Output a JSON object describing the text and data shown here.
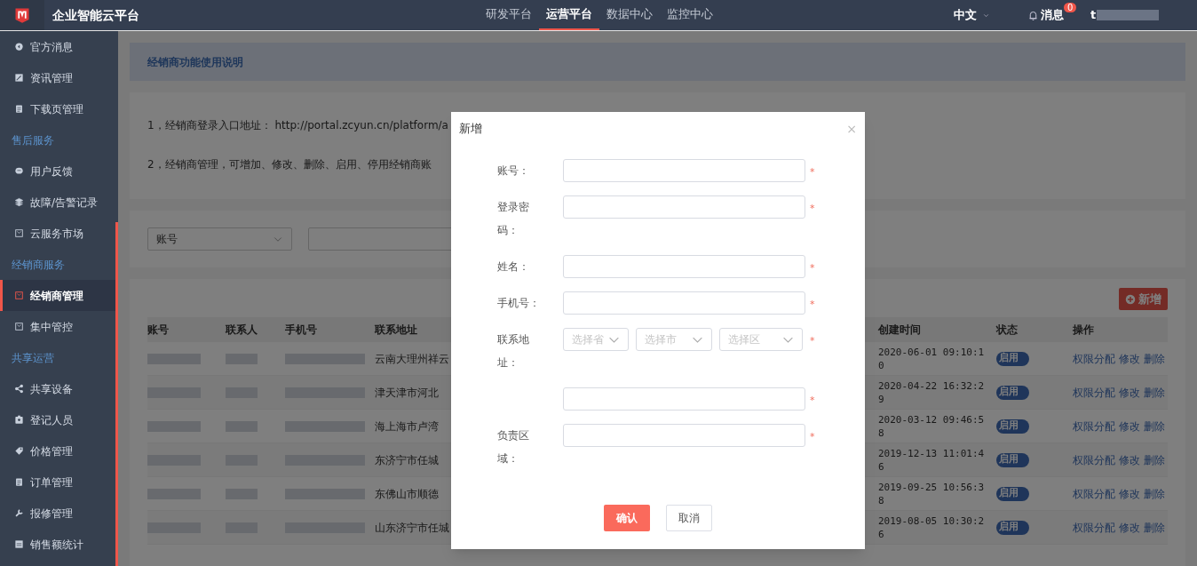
{
  "header": {
    "title": "企业智能云平台",
    "nav": [
      {
        "label": "研发平台",
        "selected": false
      },
      {
        "label": "运营平台",
        "selected": true
      },
      {
        "label": "数据中心",
        "selected": false
      },
      {
        "label": "监控中心",
        "selected": false
      }
    ],
    "language": "中文",
    "messages": {
      "label": "消息",
      "count": "0"
    },
    "user": "t"
  },
  "sidebar": [
    {
      "kind": "item",
      "label": "官方消息",
      "selected": false
    },
    {
      "kind": "item",
      "label": "资讯管理",
      "selected": false
    },
    {
      "kind": "item",
      "label": "下载页管理",
      "selected": false
    },
    {
      "kind": "section",
      "label": "售后服务"
    },
    {
      "kind": "item",
      "label": "用户反馈",
      "selected": false
    },
    {
      "kind": "item",
      "label": "故障/告警记录",
      "selected": false
    },
    {
      "kind": "item",
      "label": "云服务市场",
      "selected": false
    },
    {
      "kind": "section",
      "label": "经销商服务"
    },
    {
      "kind": "item",
      "label": "经销商管理",
      "selected": true
    },
    {
      "kind": "item",
      "label": "集中管控",
      "selected": false
    },
    {
      "kind": "section",
      "label": "共享运营"
    },
    {
      "kind": "item",
      "label": "共享设备",
      "selected": false
    },
    {
      "kind": "item",
      "label": "登记人员",
      "selected": false
    },
    {
      "kind": "item",
      "label": "价格管理",
      "selected": false
    },
    {
      "kind": "item",
      "label": "订单管理",
      "selected": false
    },
    {
      "kind": "item",
      "label": "报修管理",
      "selected": false
    },
    {
      "kind": "item",
      "label": "销售额统计",
      "selected": false
    }
  ],
  "info": {
    "title": "经销商功能使用说明",
    "lines": [
      "1，经销商登录入口地址： http://portal.zcyun.cn/platform/a",
      "2，经销商管理，可增加、修改、删除、启用、停用经销商账"
    ]
  },
  "filter": {
    "select": "账号"
  },
  "add_button": "新增",
  "table": {
    "columns_left": [
      "账号",
      "联系人",
      "手机号",
      "联系地址"
    ],
    "columns_right": [
      "创建时间",
      "状态",
      "操作"
    ],
    "rows": [
      {
        "address": "云南大理州祥云",
        "created": "2020-06-01 09:10:10",
        "status": {
          "label": "启用",
          "on": true
        },
        "actions": [
          "权限分配",
          "修改",
          "删除"
        ]
      },
      {
        "address": "津天津市河北",
        "created": "2020-04-22 16:32:29",
        "status": {
          "label": "启用",
          "on": true
        },
        "actions": [
          "权限分配",
          "修改",
          "删除"
        ]
      },
      {
        "address": "海上海市卢湾",
        "created": "2020-03-12 09:46:58",
        "status": {
          "label": "启用",
          "on": true
        },
        "actions": [
          "权限分配",
          "修改",
          "删除"
        ]
      },
      {
        "address": "东济宁市任城",
        "created": "2019-12-13 11:01:46",
        "status": {
          "label": "启用",
          "on": true
        },
        "actions": [
          "权限分配",
          "修改",
          "删除"
        ]
      },
      {
        "address": "东佛山市顺德",
        "created": "2019-09-25 10:56:38",
        "status": {
          "label": "启用",
          "on": true
        },
        "actions": [
          "权限分配",
          "修改",
          "删除"
        ]
      },
      {
        "address": "山东济宁市任城",
        "created": "2019-08-05 10:30:26",
        "status": {
          "label": "启用",
          "on": true
        },
        "actions": [
          "权限分配",
          "修改",
          "删除"
        ]
      }
    ]
  },
  "dialog": {
    "title": "新增",
    "close": "×",
    "fields": [
      {
        "kind": "input",
        "label": "账号：",
        "required_mark": "*"
      },
      {
        "kind": "input",
        "label": "登录密码：",
        "required_mark": "*"
      },
      {
        "kind": "input",
        "label": "姓名：",
        "required_mark": "*"
      },
      {
        "kind": "input",
        "label": "手机号：",
        "required_mark": "*"
      },
      {
        "kind": "selects",
        "label": "联系地址：",
        "required_mark": "*",
        "selects": [
          {
            "placeholder": "选择省"
          },
          {
            "placeholder": "选择市"
          },
          {
            "placeholder": "选择区"
          }
        ]
      },
      {
        "kind": "input",
        "required_mark": "*"
      },
      {
        "kind": "input",
        "label": "负责区域：",
        "required_mark": "*"
      }
    ],
    "buttons": [
      {
        "label": "确认",
        "kind": "primary"
      },
      {
        "label": "取消",
        "kind": "default"
      }
    ]
  }
}
